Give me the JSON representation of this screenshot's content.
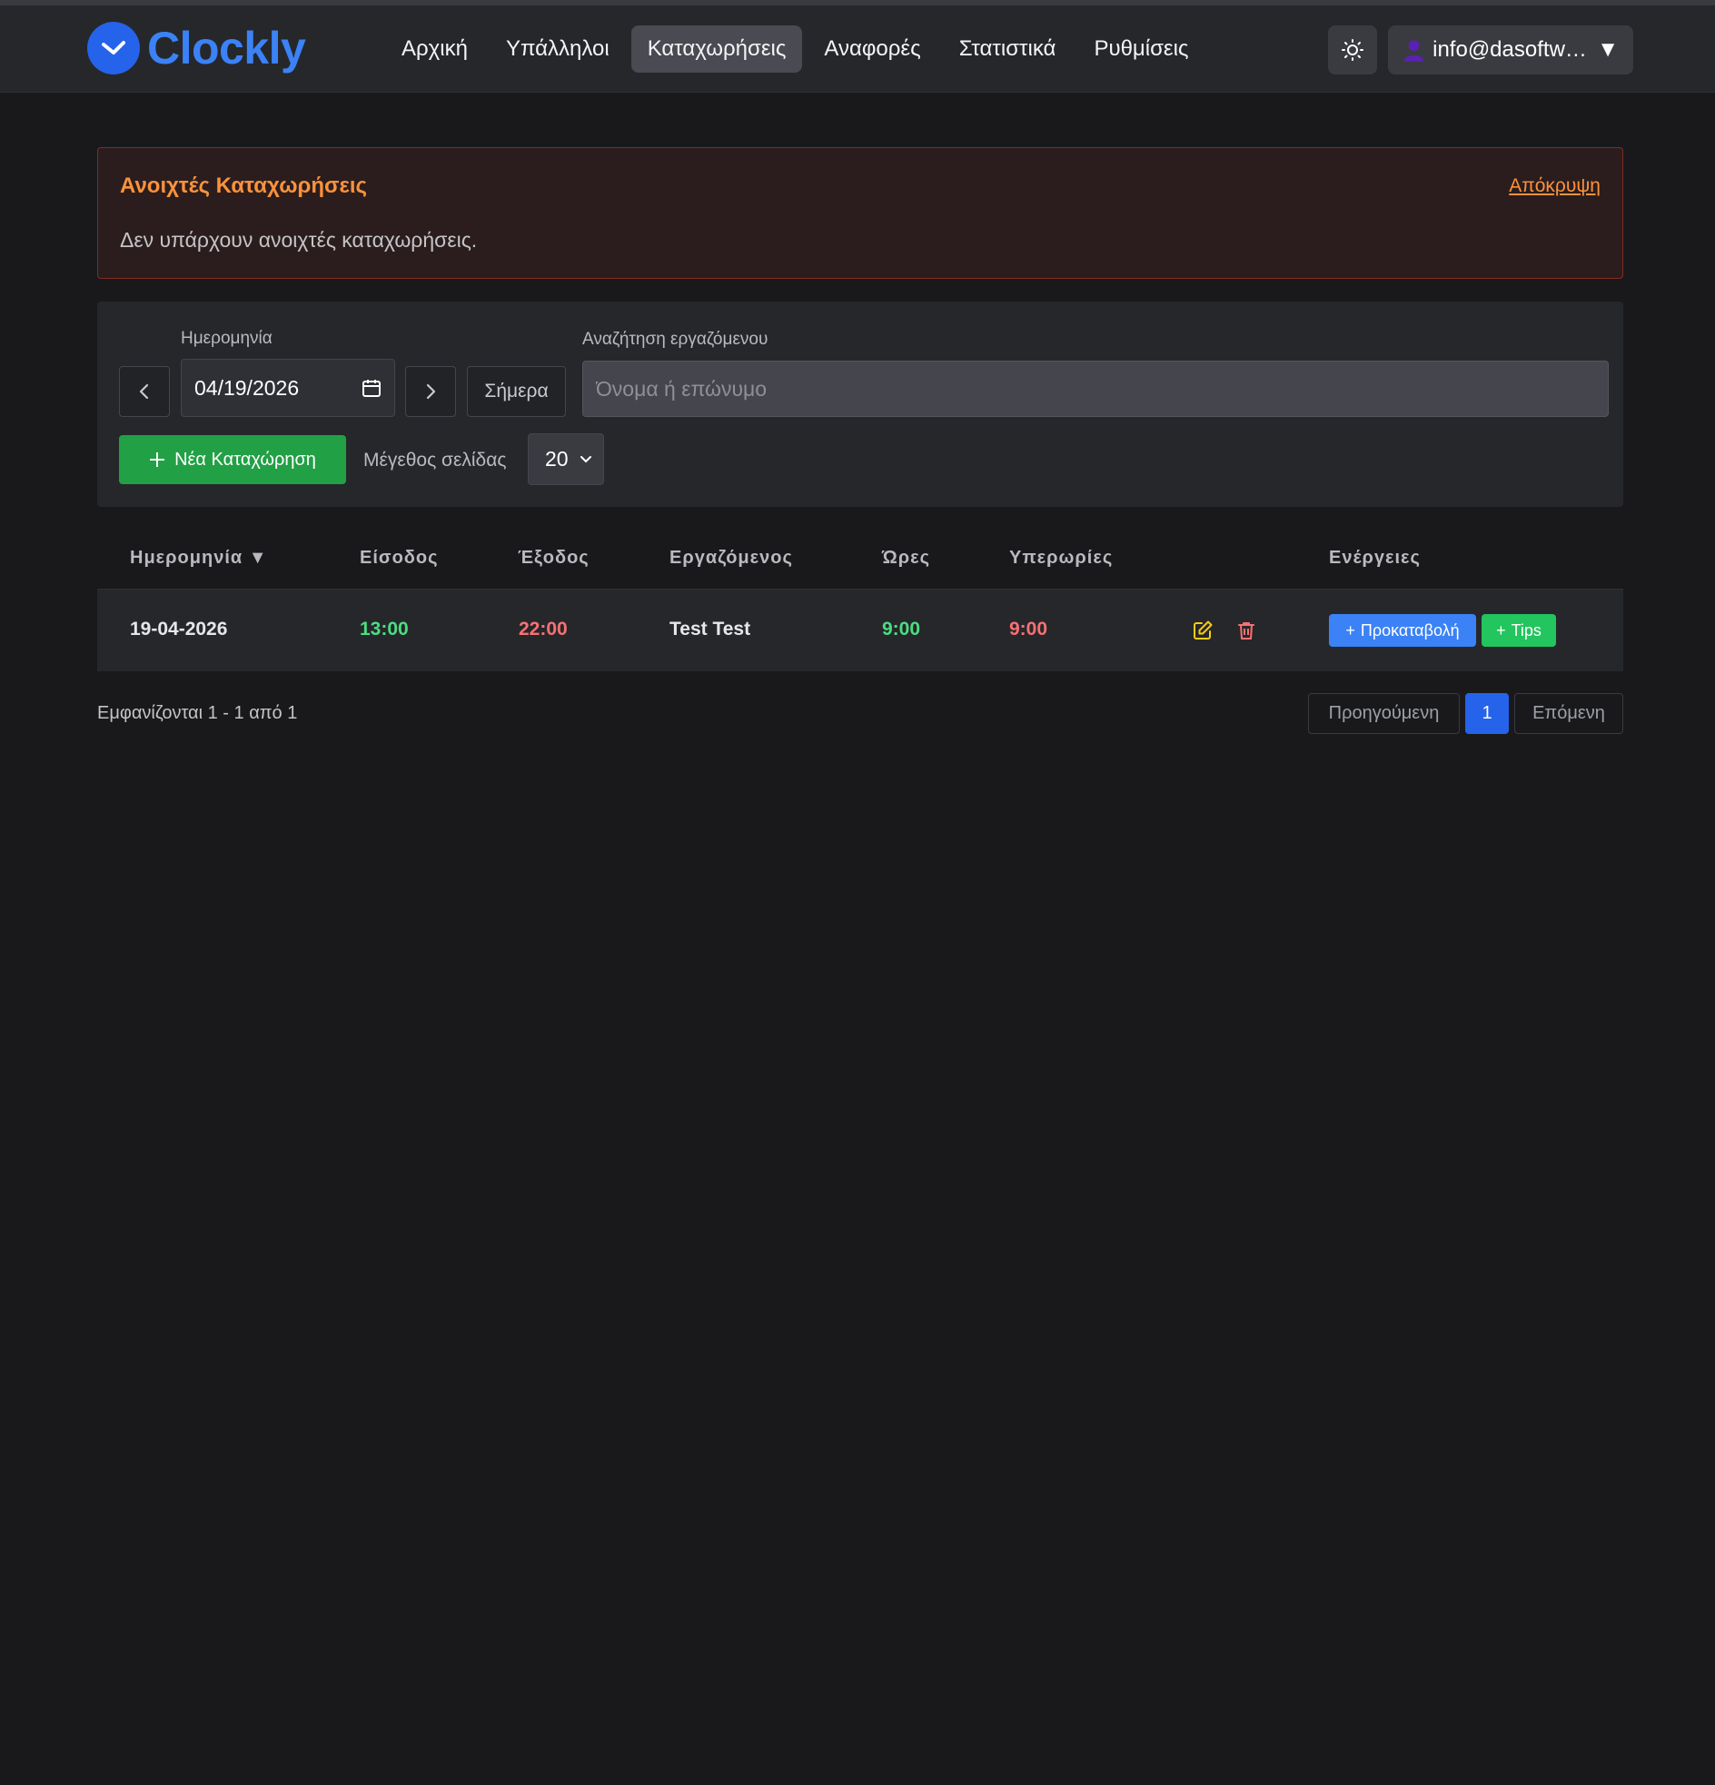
{
  "app": {
    "name": "Clockly"
  },
  "nav": {
    "items": [
      {
        "label": "Αρχική",
        "active": false
      },
      {
        "label": "Υπάλληλοι",
        "active": false
      },
      {
        "label": "Καταχωρήσεις",
        "active": true
      },
      {
        "label": "Αναφορές",
        "active": false
      },
      {
        "label": "Στατιστικά",
        "active": false
      },
      {
        "label": "Ρυθμίσεις",
        "active": false
      }
    ],
    "theme_icon": "sun-icon",
    "user_email": "info@dasoftwa...",
    "user_caret": "▼"
  },
  "alert": {
    "title": "Ανοιχτές Καταχωρήσεις",
    "hide_label": "Απόκρυψη",
    "message": "Δεν υπάρχουν ανοιχτές καταχωρήσεις."
  },
  "filters": {
    "date_label": "Ημερομηνία",
    "date_value": "04/19/2026",
    "today_label": "Σήμερα",
    "search_label": "Αναζήτηση εργαζόμενου",
    "search_placeholder": "Όνομα ή επώνυμο",
    "new_entry_label": "Νέα Καταχώρηση",
    "page_size_label": "Μέγεθος σελίδας",
    "page_size_value": "20"
  },
  "table": {
    "headers": {
      "date": "Ημερομηνία ▼",
      "entry": "Είσοδος",
      "exit": "Έξοδος",
      "employee": "Εργαζόμενος",
      "hours": "Ώρες",
      "overtime": "Υπερωρίες",
      "actions": "Ενέργειες"
    },
    "rows": [
      {
        "date": "19-04-2026",
        "entry": "13:00",
        "exit": "22:00",
        "employee": "Test Test",
        "hours": "9:00",
        "overtime": "9:00",
        "advance_label": "Προκαταβολή",
        "tips_label": "Tips"
      }
    ]
  },
  "pagination": {
    "showing": "Εμφανίζονται 1 - 1 από 1",
    "prev": "Προηγούμενη",
    "current": "1",
    "next": "Επόμενη"
  },
  "colors": {
    "accent": "#2563eb",
    "success": "#22a045",
    "entry_time": "#4ade80",
    "exit_time": "#f87171",
    "alert_title": "#fb923c"
  }
}
